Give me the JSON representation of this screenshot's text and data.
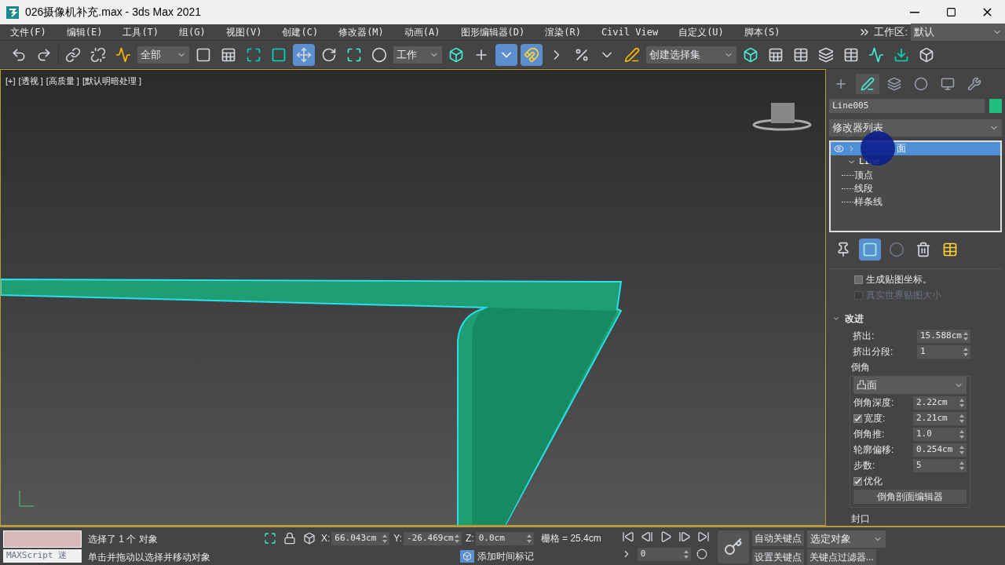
{
  "window": {
    "title": "026摄像机补充.max - 3ds Max 2021"
  },
  "menu": [
    "文件(F)",
    "编辑(E)",
    "工具(T)",
    "组(G)",
    "视图(V)",
    "创建(C)",
    "修改器(M)",
    "动画(A)",
    "图形编辑器(D)",
    "渲染(R)",
    "Civil View",
    "自定义(U)",
    "脚本(S)"
  ],
  "workspace": {
    "label": "工作区:",
    "value": "默认"
  },
  "toolbar": {
    "selection_filter": "全部",
    "coordinate_system": "工作",
    "named_selection": "创建选择集",
    "move_selected": true,
    "snap_selected": true,
    "keyboard_override_selected": true
  },
  "viewport": {
    "labels": [
      "[+]",
      "[透视 ]",
      "[高质量 ]",
      "[默认明暗处理 ]"
    ]
  },
  "command_panel": {
    "tabs": [
      {
        "selected": false
      },
      {
        "selected": true
      },
      {
        "selected": false
      },
      {
        "selected": false
      },
      {
        "selected": false
      },
      {
        "selected": false
      }
    ],
    "object_name": "Line005",
    "modifier_list": "修改器列表",
    "stack": [
      {
        "label": "面",
        "selected": true,
        "visible": true,
        "expanded": false
      },
      {
        "label": "Line",
        "selected": false,
        "expanded": true,
        "children": [
          {
            "label": "顶点"
          },
          {
            "label": "线段"
          },
          {
            "label": "样条线"
          }
        ]
      }
    ],
    "show_end_result": true,
    "partial_rollout": [
      {
        "label": "生成贴图坐标。",
        "checked": false,
        "disabled": false
      },
      {
        "label": "真实世界贴图大小",
        "checked": false,
        "disabled": true
      }
    ],
    "rollout": {
      "title": "改进",
      "expanded": true,
      "fields_top": [
        {
          "label": "挤出:",
          "value": "15.588cm"
        },
        {
          "label": "挤出分段:",
          "value": "1"
        }
      ],
      "group": {
        "title": "倒角",
        "dropdown": "凸面",
        "rows": [
          {
            "kind": "field",
            "label": "倒角深度:",
            "value": "2.22cm"
          },
          {
            "kind": "checkfield",
            "label": "宽度:",
            "value": "2.21cm",
            "checked": true
          },
          {
            "kind": "field",
            "label": "倒角推:",
            "value": "1.0"
          },
          {
            "kind": "field",
            "label": "轮廓偏移:",
            "value": "0.254cm"
          },
          {
            "kind": "field",
            "label": "步数:",
            "value": "5"
          },
          {
            "kind": "check",
            "label": "优化",
            "checked": true
          }
        ],
        "button": "倒角剖面编辑器"
      },
      "next_group": "封口"
    }
  },
  "status": {
    "listener": "MAXScript 迷",
    "selection": "选择了 1 个 对象",
    "prompt": "单击并拖动以选择并移动对象",
    "coords": [
      {
        "axis": "X:",
        "value": "66.043cm"
      },
      {
        "axis": "Y:",
        "value": "-26.469cm"
      },
      {
        "axis": "Z:",
        "value": "0.0cm"
      }
    ],
    "grid": "栅格 = 25.4cm",
    "time_tag": "添加时间标记",
    "frame": "0",
    "auto_key": "自动关键点",
    "key_mode": "选定对象",
    "set_key": "设置关键点",
    "key_filters": "关键点过滤器..."
  }
}
